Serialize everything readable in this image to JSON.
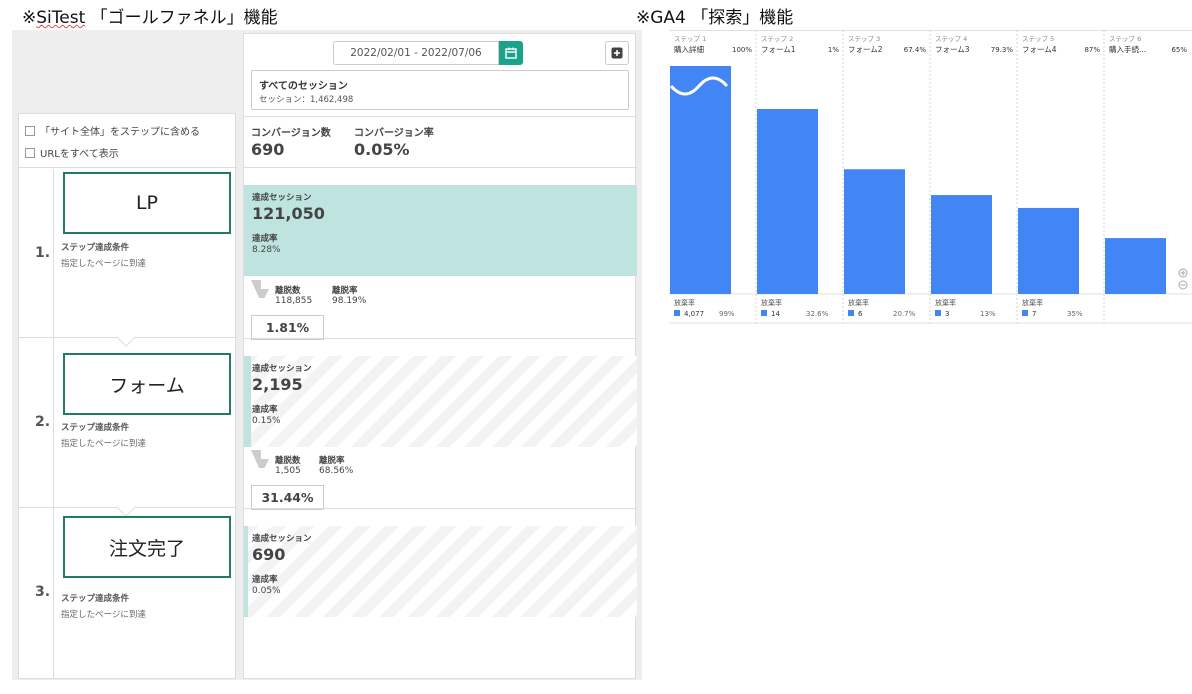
{
  "captions": {
    "left_mark": "※",
    "left_brand": "SiTest",
    "left_rest": " 「ゴールファネル」機能",
    "right": "※GA4 「探索」機能"
  },
  "sitest": {
    "date_range": "2022/02/01 - 2022/07/06",
    "calendar_icon": "calendar-icon",
    "add_icon": "add-icon",
    "segment": {
      "title": "すべてのセッション",
      "sessions": "セッション：1,462,498"
    },
    "options": {
      "include_site": "「サイト全体」をステップに含める",
      "show_urls": "URLをすべて表示"
    },
    "kpi": {
      "conversions_label": "コンバージョン数",
      "conversions_value": "690",
      "cvr_label": "コンバージョン率",
      "cvr_value": "0.05%"
    },
    "steps": [
      {
        "number": "1.",
        "card": "LP",
        "cond_label": "ステップ達成条件",
        "cond_desc": "指定したページに到達",
        "sessions_label": "達成セッション",
        "sessions": "121,050",
        "rate_label": "達成率",
        "rate": "8.28%",
        "fill": 1.0,
        "exit_count_label": "離脱数",
        "exit_count": "118,855",
        "exit_rate_label": "離脱率",
        "exit_rate": "98.19%",
        "pass_rate": "1.81%"
      },
      {
        "number": "2.",
        "card": "フォーム",
        "cond_label": "ステップ達成条件",
        "cond_desc": "指定したページに到達",
        "sessions_label": "達成セッション",
        "sessions": "2,195",
        "rate_label": "達成率",
        "rate": "0.15%",
        "fill": 0.018,
        "exit_count_label": "離脱数",
        "exit_count": "1,505",
        "exit_rate_label": "離脱率",
        "exit_rate": "68.56%",
        "pass_rate": "31.44%"
      },
      {
        "number": "3.",
        "card": "注文完了",
        "cond_label": "ステップ達成条件",
        "cond_desc": "指定したページに到達",
        "sessions_label": "達成セッション",
        "sessions": "690",
        "rate_label": "達成率",
        "rate": "0.05%",
        "fill": 0.006
      }
    ]
  },
  "ga4": {
    "plus_icon": "zoom-in-icon",
    "minus_icon": "zoom-out-icon",
    "bar_color": "#4285f4",
    "drop_label": "放棄率"
  },
  "chart_data": {
    "type": "bar",
    "steps": [
      "ステップ 1",
      "ステップ 2",
      "ステップ 3",
      "ステップ 4",
      "ステップ 5",
      "ステップ 6"
    ],
    "categories": [
      "購入詳細",
      "フォーム1",
      "フォーム2",
      "フォーム3",
      "フォーム4",
      "購入手続..."
    ],
    "completion_rates": [
      "100%",
      "1%",
      "67.4%",
      "79.3%",
      "87%",
      "65%"
    ],
    "values": [
      53,
      43,
      29,
      23,
      20,
      13
    ],
    "y_ticks": [
      "53",
      "27",
      "0"
    ],
    "ylim": [
      0,
      53
    ],
    "abandon_counts": [
      "4,077",
      "14",
      "6",
      "3",
      "7"
    ],
    "abandon_rates": [
      "99%",
      "32.6%",
      "20.7%",
      "13%",
      "35%"
    ],
    "grid": true
  }
}
